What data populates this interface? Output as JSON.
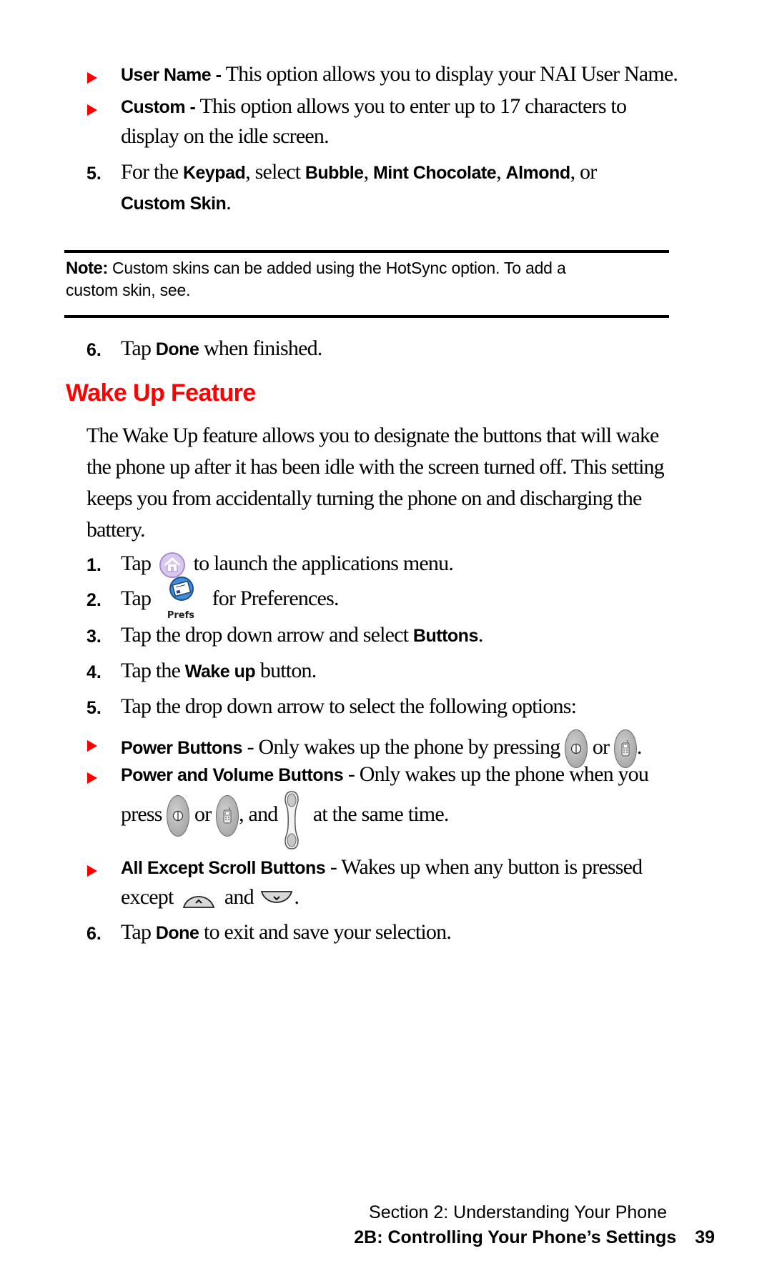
{
  "colors": {
    "accent_red": "#ff0000",
    "text": "#000000",
    "rule": "#000000"
  },
  "bullets_top": [
    {
      "label": "User Name -",
      "text": " This option allows you to display your NAI User Name."
    },
    {
      "label": "Custom -",
      "text": " This option allows you to enter up to 17 characters to",
      "text_cont": "display on the idle screen."
    }
  ],
  "step5_top": {
    "num": "5.",
    "t1": "For the ",
    "b1": "Keypad",
    "t2": ", select ",
    "b2": "Bubble",
    "t3": ", ",
    "b3": "Mint Chocolate",
    "t4": ", ",
    "b4": "Almond",
    "t5": ", or",
    "b5": "Custom Skin",
    "t6": "."
  },
  "note": {
    "label": "Note:",
    "text": " Custom skins can be added using the HotSync option. To add a",
    "text_cont": "custom skin, see."
  },
  "step6_top": {
    "num": "6.",
    "t1": "Tap ",
    "b1": "Done",
    "t2": " when finished."
  },
  "section": {
    "heading": "Wake Up Feature",
    "intro": "The Wake Up feature allows you to designate the buttons that will wake the phone up after it has been idle with the screen turned off. This setting keeps you from accidentally turning the phone on and discharging the battery."
  },
  "steps": [
    {
      "num": "1.",
      "t1": "Tap",
      "icon": "home-icon",
      "t2": "to launch the applications menu."
    },
    {
      "num": "2.",
      "t1": "Tap",
      "icon": "prefs-icon",
      "icon_label": "Prefs",
      "t2": "for Preferences."
    },
    {
      "num": "3.",
      "t1": "Tap the drop down arrow and select ",
      "b1": "Buttons",
      "t2": "."
    },
    {
      "num": "4.",
      "t1": "Tap the ",
      "b1": "Wake up",
      "t2": " button."
    },
    {
      "num": "5.",
      "t1": "Tap the drop down arrow to select the following options:"
    }
  ],
  "options": [
    {
      "label": "Power Buttons",
      "t1": " - Only wakes up the phone by pressing ",
      "t2": " or ",
      "t3": "."
    },
    {
      "label": "Power and Volume Buttons",
      "t1": " - Only wakes up the phone when you",
      "c1": "press ",
      "c2": " or ",
      "c3": ", and ",
      "c4": " at the same time."
    },
    {
      "label": "All Except Scroll Buttons",
      "t1": " - Wakes up when any button is pressed",
      "c1": "except ",
      "c2": " and ",
      "c3": "."
    }
  ],
  "step6_bottom": {
    "num": "6.",
    "t1": "Tap ",
    "b1": "Done",
    "t2": " to exit and save your selection."
  },
  "footer": {
    "section": "Section 2: Understanding Your Phone",
    "chapter": "2B: Controlling Your Phone’s Settings",
    "page": "39"
  }
}
